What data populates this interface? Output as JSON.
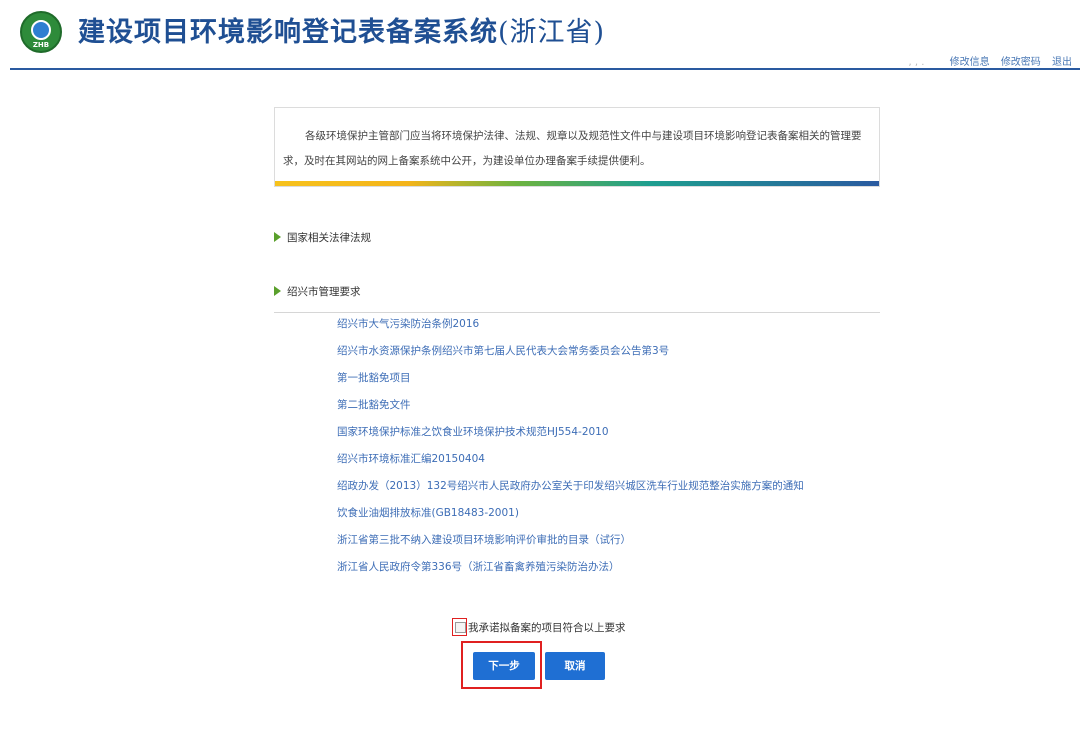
{
  "header": {
    "logo_text": "ZHB",
    "title_main": "建设项目环境影响登记表备案系统",
    "title_province": "(浙江省)",
    "nav": {
      "dots": ", ,    .",
      "edit_info": "修改信息",
      "change_password": "修改密码",
      "logout": "退出"
    }
  },
  "notice": {
    "text": "各级环境保护主管部门应当将环境保护法律、法规、规章以及规范性文件中与建设项目环境影响登记表备案相关的管理要求，及时在其网站的网上备案系统中公开，为建设单位办理备案手续提供便利。"
  },
  "sections": [
    {
      "title": "国家相关法律法规"
    },
    {
      "title": "绍兴市管理要求"
    }
  ],
  "links": [
    "绍兴市大气污染防治条例2016",
    "绍兴市水资源保护条例绍兴市第七届人民代表大会常务委员会公告第3号",
    "第一批豁免项目",
    "第二批豁免文件",
    "国家环境保护标准之饮食业环境保护技术规范HJ554-2010",
    "绍兴市环境标准汇编20150404",
    "绍政办发（2013）132号绍兴市人民政府办公室关于印发绍兴城区洗车行业规范整治实施方案的通知",
    "饮食业油烟排放标准(GB18483-2001)",
    "浙江省第三批不纳入建设项目环境影响评价审批的目录（试行）",
    "浙江省人民政府令第336号（浙江省畜禽养殖污染防治办法）"
  ],
  "agreement": {
    "label": "我承诺拟备案的项目符合以上要求",
    "checked": false
  },
  "buttons": {
    "next": "下一步",
    "cancel": "取消"
  },
  "colors": {
    "brand_blue": "#1f4f93",
    "button_blue": "#1f6fd3",
    "link_blue": "#3d6db6",
    "highlight_red": "#e02020"
  }
}
